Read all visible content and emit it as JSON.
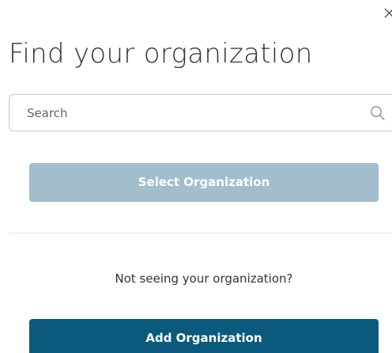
{
  "dialog": {
    "title": "Find your organization",
    "close_icon": "close-icon"
  },
  "search": {
    "placeholder": "Search",
    "value": "",
    "icon": "search-icon"
  },
  "actions": {
    "select_label": "Select Organization",
    "not_seeing_text": "Not seeing your organization?",
    "add_label": "Add Organization"
  },
  "colors": {
    "select_button_disabled": "#a2bdcc",
    "add_button": "#0b5a7e",
    "text": "#333333",
    "border": "#c9c9c9",
    "divider": "#e3e3e3"
  }
}
